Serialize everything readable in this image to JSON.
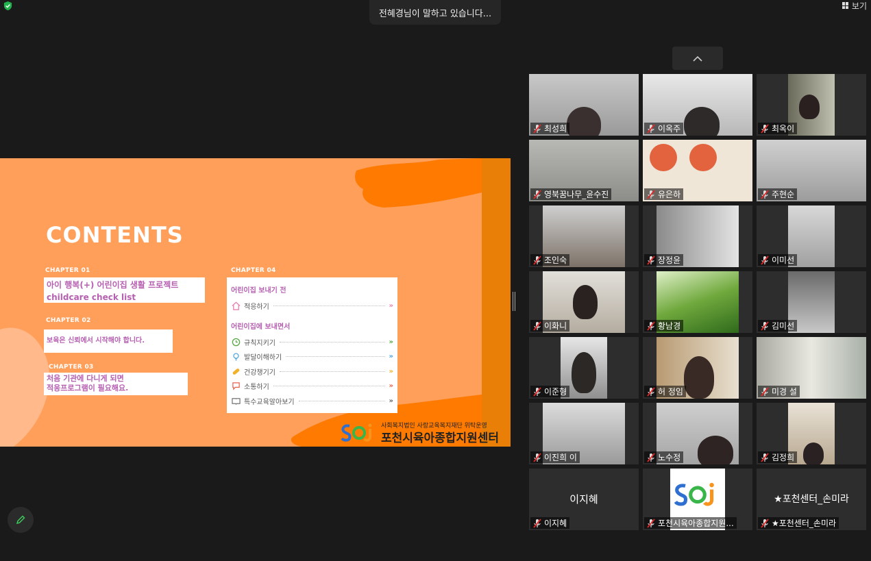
{
  "app": {
    "speaking_banner": "전혜경님이 말하고 있습니다...",
    "view_label": "보기"
  },
  "slide": {
    "title": "CONTENTS",
    "chapters": [
      {
        "label": "CHAPTER 01",
        "lines": [
          "아이 행복(+) 어린이집 생활 프로젝트",
          "childcare check list"
        ]
      },
      {
        "label": "CHAPTER 02",
        "lines": [
          "보육은 신뢰에서 시작해야 합니다."
        ]
      },
      {
        "label": "CHAPTER 03",
        "lines": [
          "처음 기관에 다니게 되면",
          "적응프로그램이 필요해요."
        ]
      }
    ],
    "chapter4": {
      "label": "CHAPTER 04",
      "section1": "어린이집 보내기 전",
      "section1_items": [
        {
          "label": "적응하기",
          "icon": "house-icon",
          "color": "#e97fb0"
        }
      ],
      "section2": "어린이집에 보내면서",
      "section2_items": [
        {
          "label": "규칙지키기",
          "icon": "clock-icon",
          "color": "#57a845"
        },
        {
          "label": "발달이해하기",
          "icon": "bulb-icon",
          "color": "#4aa3df"
        },
        {
          "label": "건강챙기기",
          "icon": "pill-icon",
          "color": "#f0b22b"
        },
        {
          "label": "소통하기",
          "icon": "chat-icon",
          "color": "#e8604c"
        },
        {
          "label": "특수교육알아보기",
          "icon": "book-icon",
          "color": "#666666"
        }
      ]
    },
    "org_sub": "사회복지법인 사랑교육복지재단 위탁운영",
    "org_main": "포천시육아종합지원센터"
  },
  "participants": [
    {
      "name": "최성희"
    },
    {
      "name": "이옥주"
    },
    {
      "name": "최옥이"
    },
    {
      "name": "영북꿈나무_윤수진"
    },
    {
      "name": "유은하"
    },
    {
      "name": "주현순"
    },
    {
      "name": "조인숙"
    },
    {
      "name": "장정윤"
    },
    {
      "name": "이미선"
    },
    {
      "name": "이화니"
    },
    {
      "name": "황남경"
    },
    {
      "name": "김미선"
    },
    {
      "name": "이준형"
    },
    {
      "name": "허 정임"
    },
    {
      "name": "미경 설"
    },
    {
      "name": "이진희 이"
    },
    {
      "name": "노수정"
    },
    {
      "name": "김정희"
    },
    {
      "name": "이지혜",
      "big": "이지혜"
    },
    {
      "name": "포천시육아종합지원..."
    },
    {
      "name": "★포천센터_손미라",
      "big": "★포천센터_손미라"
    }
  ],
  "colors": {
    "slide_bg": "#ff9f5a",
    "slide_accent": "#ff7a00",
    "chapter_text": "#b65fb1",
    "muted_red": "#e02828"
  }
}
